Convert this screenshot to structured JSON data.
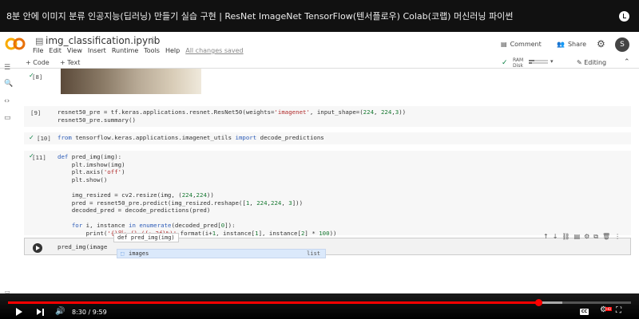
{
  "video": {
    "title": "8분 안에 이미지 분류 인공지능(딥러닝) 만들기 실습 구현 | ResNet ImageNet TensorFlow(텐서플로우) Colab(코랩) 머신러닝 파이썬",
    "time": "8:30 / 9:59",
    "progress_fraction": 0.851,
    "buffered_fraction": 0.89,
    "hd_badge": "HD",
    "cc_label": "CC"
  },
  "colab": {
    "logo_text": "CO",
    "notebook_title": "img_classification.ipynb",
    "menu": [
      "File",
      "Edit",
      "View",
      "Insert",
      "Runtime",
      "Tools",
      "Help"
    ],
    "changes_saved": "All changes saved",
    "comment_label": "Comment",
    "share_label": "Share",
    "avatar_letter": "S",
    "add_code": "+ Code",
    "add_text": "+ Text",
    "ram_label": "RAM",
    "disk_label": "Disk",
    "ram_fraction": 0.3,
    "disk_fraction": 0.15,
    "editing_label": "Editing"
  },
  "cells": {
    "c8": {
      "prompt": "[8]"
    },
    "c9": {
      "prompt": "[9]",
      "line1_a": "resnet50_pre = tf.keras.applications.resnet.ResNet50(weights=",
      "line1_str": "'imagenet'",
      "line1_b": ", input_shape=(",
      "line1_n1": "224",
      "line1_c": ", ",
      "line1_n2": "224",
      "line1_d": ",",
      "line1_n3": "3",
      "line1_e": "))",
      "line2": "resnet50_pre.summary()"
    },
    "c10": {
      "prompt": "[10]",
      "kw_from": "from",
      "module": " tensorflow.keras.applications.imagenet_utils ",
      "kw_import": "import",
      "name": " decode_predictions"
    },
    "c11": {
      "prompt": "[11]",
      "def_kw": "def",
      "def_rest": " pred_img(img):",
      "l2": "    plt.imshow(img)",
      "l3_a": "    plt.axis(",
      "l3_str": "'off'",
      "l3_b": ")",
      "l4": "    plt.show()",
      "l6_a": "    img_resized = cv2.resize(img, (",
      "l6_n1": "224",
      "l6_b": ",",
      "l6_n2": "224",
      "l6_c": "))",
      "l7_a": "    pred = resnet50_pre.predict(img_resized.reshape([",
      "l7_n1": "1",
      "l7_b": ", ",
      "l7_n2": "224",
      "l7_c": ",",
      "l7_n3": "224",
      "l7_d": ", ",
      "l7_n4": "3",
      "l7_e": "]))",
      "l8": "    decoded_pred = decode_predictions(pred)",
      "l10_for": "for",
      "l10_a": " i, instance ",
      "l10_in": "in",
      "l10_enum": " enumerate",
      "l10_b": "(decoded_pred[",
      "l10_n": "0",
      "l10_c": "]):",
      "l11_a": "        print(",
      "l11_str": "'{}위: {} ({:.2f}%)'",
      "l11_b": ".format(i+",
      "l11_n1": "1",
      "l11_c": ", instance[",
      "l11_n2": "1",
      "l11_d": "], instance[",
      "l11_n3": "2",
      "l11_e": "] * ",
      "l11_n4": "100",
      "l11_f": "))"
    },
    "active": {
      "input": "pred_img(image",
      "tooltip": "def pred_img(img)",
      "autocomplete_name": "images",
      "autocomplete_type": "list"
    }
  }
}
